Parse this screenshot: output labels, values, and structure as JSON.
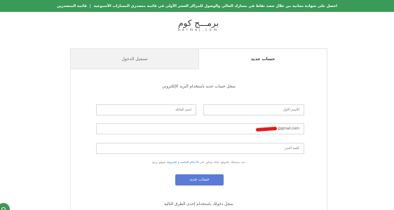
{
  "banner": {
    "text": "احصل على شهادة مجانية من خلال حصد نقاط في مسارك الحالي والوصول للمراكز العشر الأولى في قائمة متصدري المسارات الأسبوعية",
    "separator": "|",
    "link": "قائمة المتصدرين"
  },
  "logo": {
    "main": "برمـــج كوم",
    "sub": "barmej.com"
  },
  "tabs": [
    {
      "label": "حساب جديد",
      "active": true
    },
    {
      "label": "تسجيل الدخول",
      "active": false
    }
  ],
  "form": {
    "heading": "سجل حساب جديد باستخدام البريد الإلكتروني",
    "first_name_placeholder": "الاسم الأول",
    "last_name_placeholder": "اسم العائلة",
    "email_value": "@gmail.com",
    "password_placeholder": "كلمة السر",
    "terms_prefix": "عند تسجيلك بالموقع، فإنك توافق على",
    "terms_link": "الأحكام الخاصة و الشروط",
    "terms_suffix": "بموقع برمج",
    "submit_label": "حساب جديد",
    "social_heading": "سجل دخولك باستخدام إحدى الطرق التالية"
  },
  "colors": {
    "banner_bg": "#3c9a58",
    "button_bg": "#5b7cd6",
    "link": "#3b7fc4"
  },
  "icons": {
    "help": "help-circle-icon"
  }
}
